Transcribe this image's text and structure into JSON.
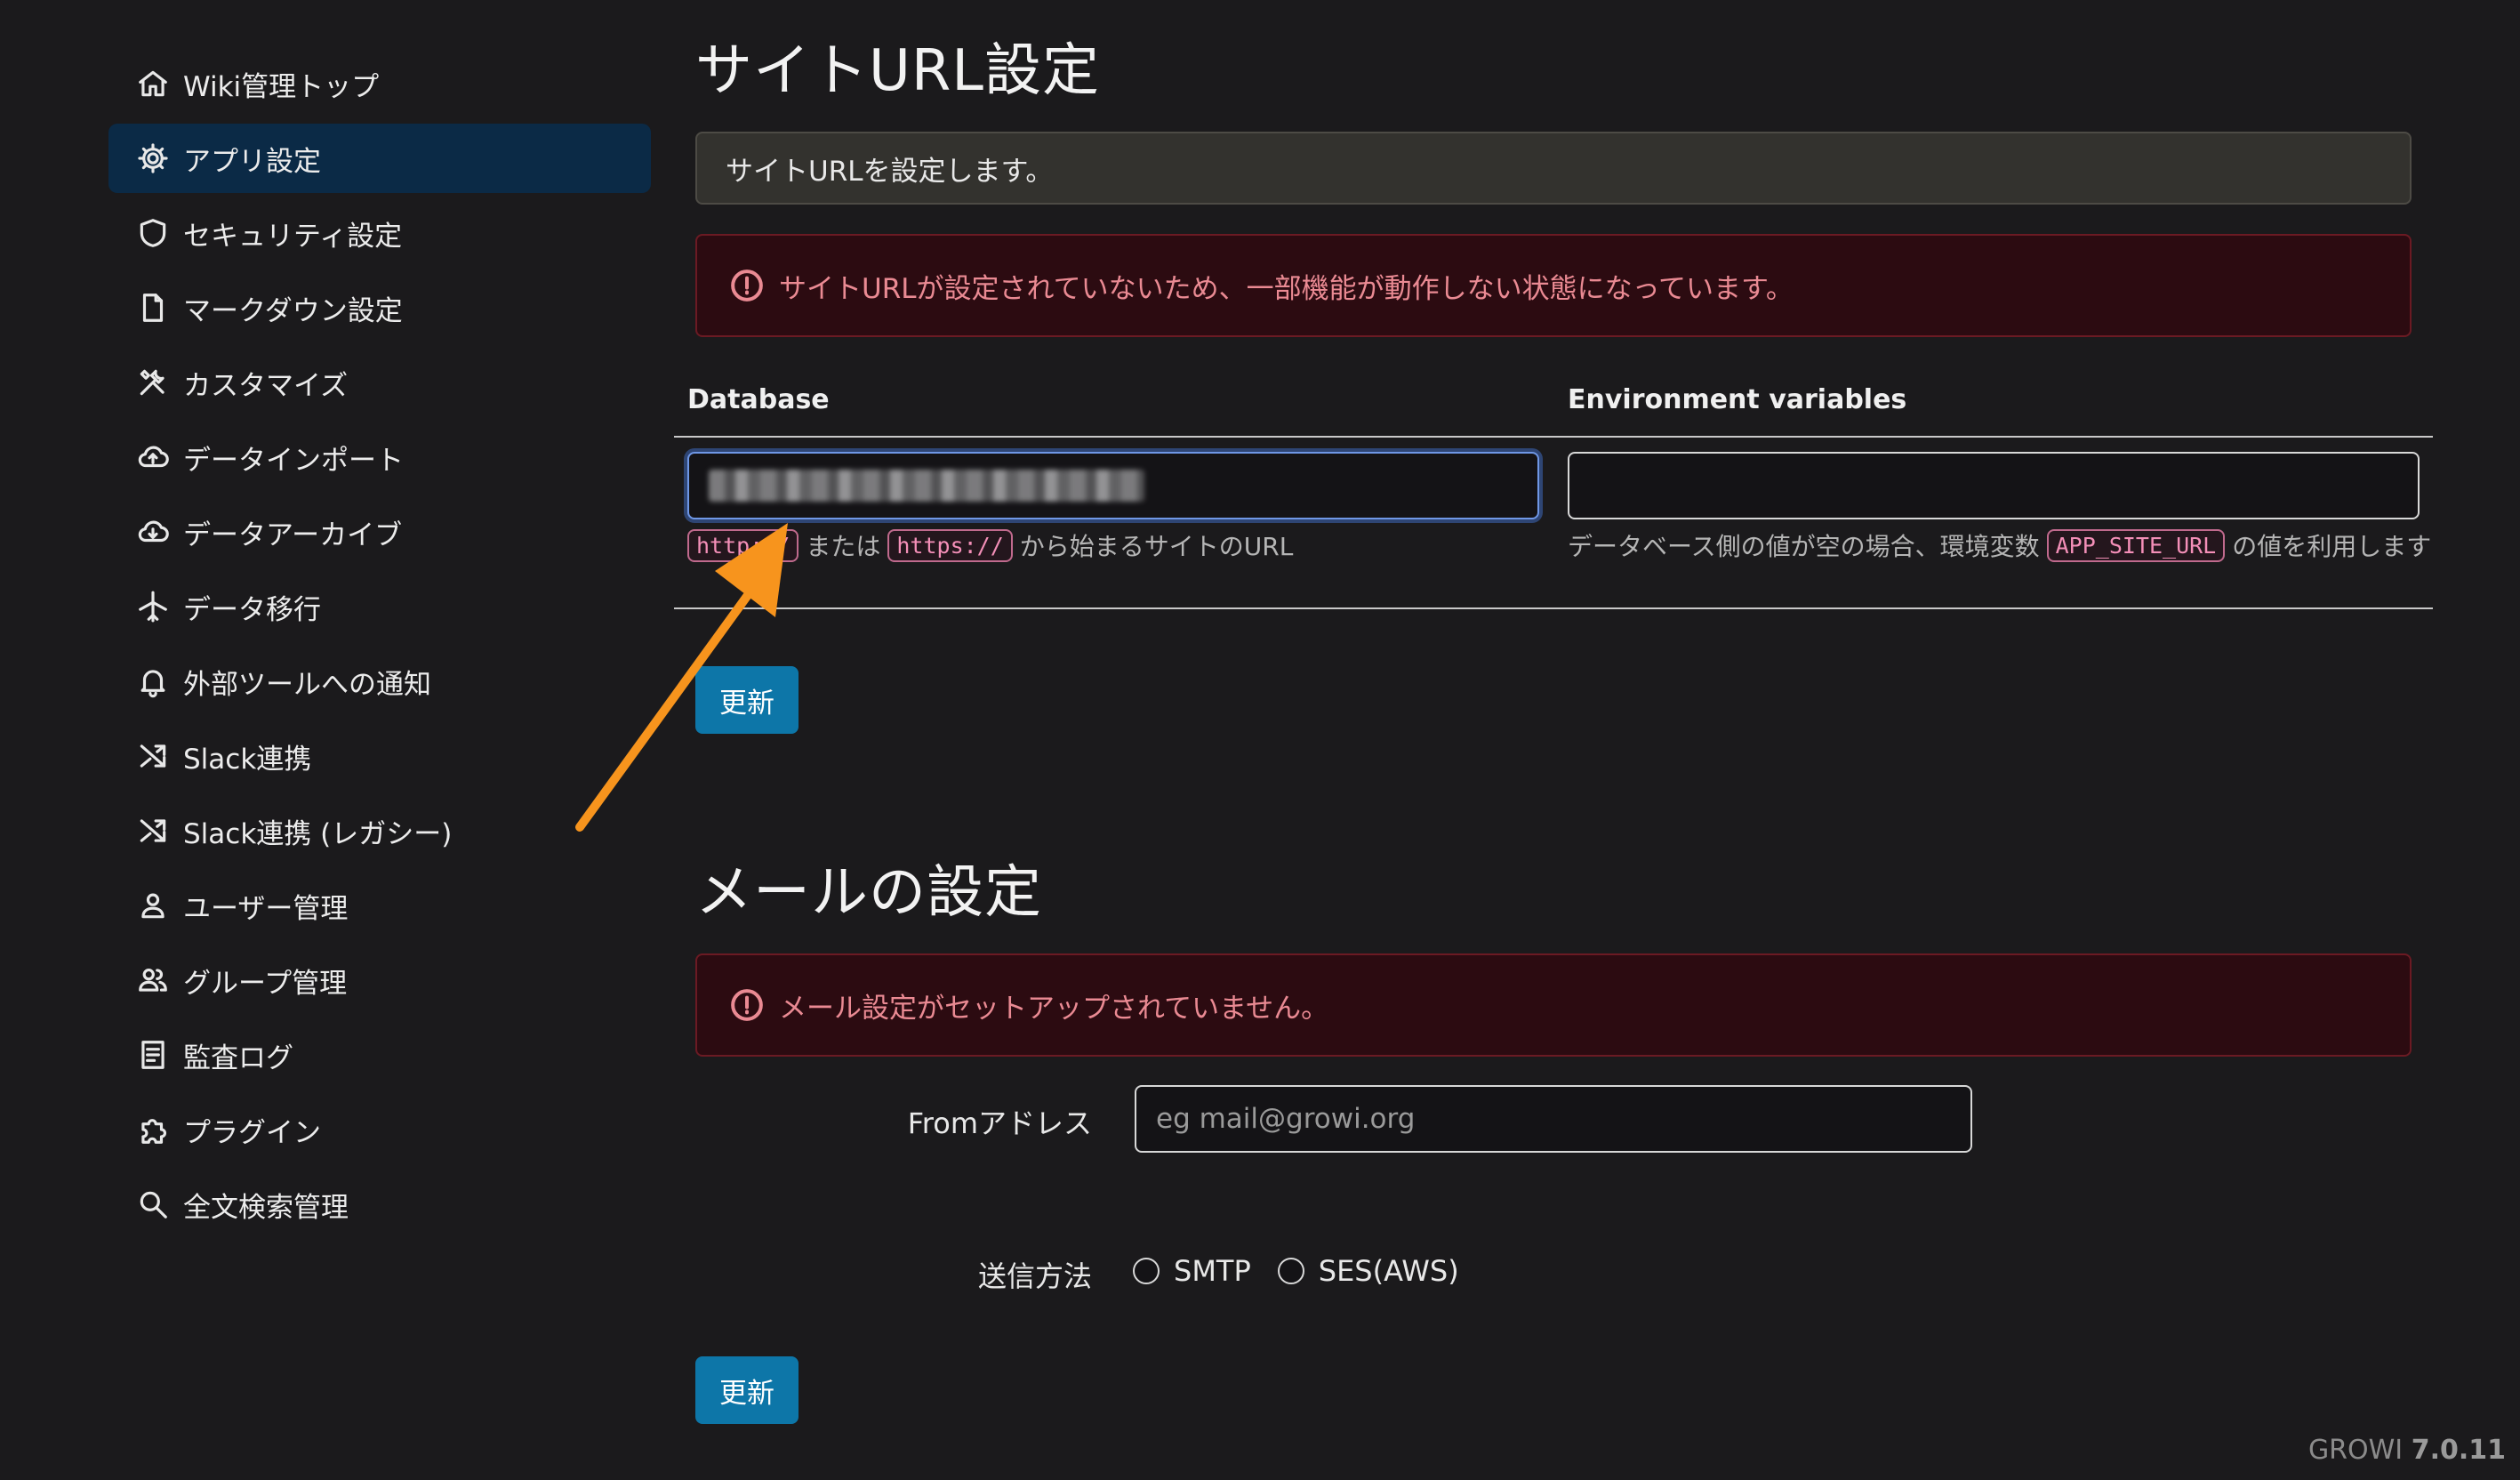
{
  "sidebar": {
    "items": [
      {
        "label": "Wiki管理トップ",
        "icon": "home-icon"
      },
      {
        "label": "アプリ設定",
        "icon": "gear-icon",
        "active": true
      },
      {
        "label": "セキュリティ設定",
        "icon": "shield-icon"
      },
      {
        "label": "マークダウン設定",
        "icon": "file-icon"
      },
      {
        "label": "カスタマイズ",
        "icon": "tools-icon"
      },
      {
        "label": "データインポート",
        "icon": "cloud-upload-icon"
      },
      {
        "label": "データアーカイブ",
        "icon": "cloud-download-icon"
      },
      {
        "label": "データ移行",
        "icon": "airplane-icon"
      },
      {
        "label": "外部ツールへの通知",
        "icon": "bell-icon"
      },
      {
        "label": "Slack連携",
        "icon": "shuffle-icon"
      },
      {
        "label": "Slack連携 (レガシー)",
        "icon": "shuffle-icon"
      },
      {
        "label": "ユーザー管理",
        "icon": "user-icon"
      },
      {
        "label": "グループ管理",
        "icon": "group-icon"
      },
      {
        "label": "監査ログ",
        "icon": "document-list-icon"
      },
      {
        "label": "プラグイン",
        "icon": "puzzle-icon"
      },
      {
        "label": "全文検索管理",
        "icon": "search-icon"
      }
    ]
  },
  "site_url": {
    "title": "サイトURL設定",
    "info": "サイトURLを設定します。",
    "alert": "サイトURLが設定されていないため、一部機能が動作しない状態になっています。",
    "col_database": "Database",
    "col_env": "Environment variables",
    "db_help": {
      "code1": "http://",
      "mid": "または",
      "code2": "https://",
      "tail": "から始まるサイトのURL"
    },
    "env_help": {
      "head": "データベース側の値が空の場合、環境変数",
      "code": "APP_SITE_URL",
      "tail": "の値を利用します"
    },
    "update_label": "更新"
  },
  "mail": {
    "title": "メールの設定",
    "alert": "メール設定がセットアップされていません。",
    "from_label": "Fromアドレス",
    "from_placeholder": "eg mail@growi.org",
    "method_label": "送信方法",
    "options": [
      "SMTP",
      "SES(AWS)"
    ],
    "update_label": "更新"
  },
  "footer": {
    "brand": "GROWI",
    "version": "7.0.11"
  },
  "colors": {
    "accent": "#0d76a8",
    "active_nav": "#0b2a46",
    "alert_text": "#ea8a93",
    "arrow": "#f7941d"
  }
}
